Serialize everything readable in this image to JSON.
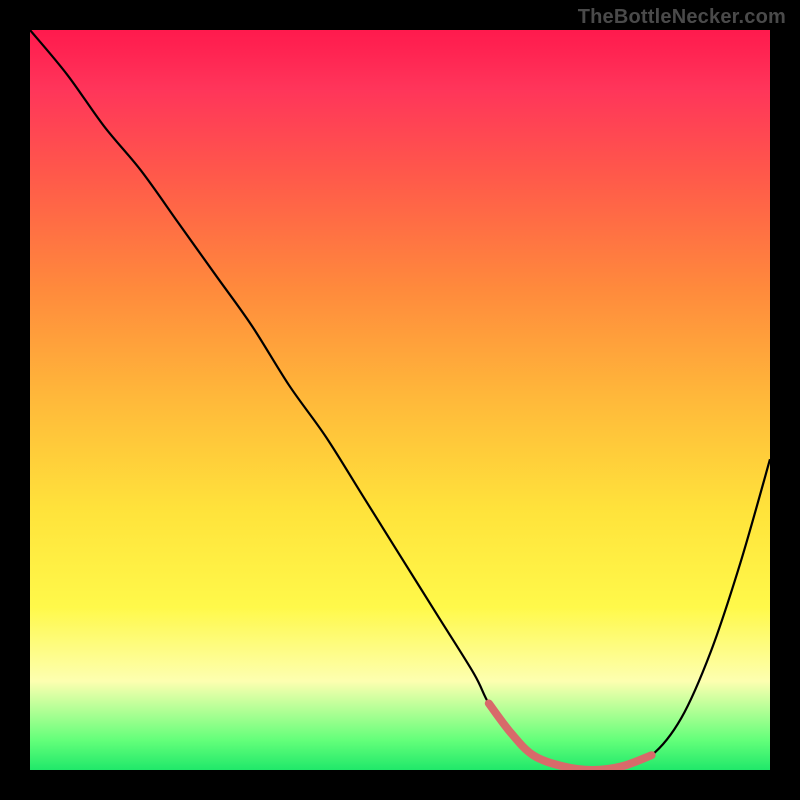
{
  "watermark": "TheBottleNecker.com",
  "colors": {
    "accent": "#d86a6a",
    "line": "#000000"
  },
  "chart_data": {
    "type": "line",
    "title": "",
    "xlabel": "",
    "ylabel": "",
    "xlim": [
      0,
      100
    ],
    "ylim": [
      0,
      100
    ],
    "x": [
      0,
      5,
      10,
      15,
      20,
      25,
      30,
      35,
      40,
      45,
      50,
      55,
      60,
      62,
      65,
      68,
      72,
      76,
      80,
      84,
      88,
      92,
      96,
      100
    ],
    "y": [
      100,
      94,
      87,
      81,
      74,
      67,
      60,
      52,
      45,
      37,
      29,
      21,
      13,
      9,
      5,
      2,
      0.5,
      0,
      0.5,
      2,
      7,
      16,
      28,
      42
    ],
    "highlight_range_x": [
      62,
      84
    ],
    "notes": "V-shaped bottleneck curve; minimum (optimal, ~0% bottleneck) plateau around x≈72–80; values estimated from pixel positions on a 0–100 normalized grid since no axes are shown."
  }
}
